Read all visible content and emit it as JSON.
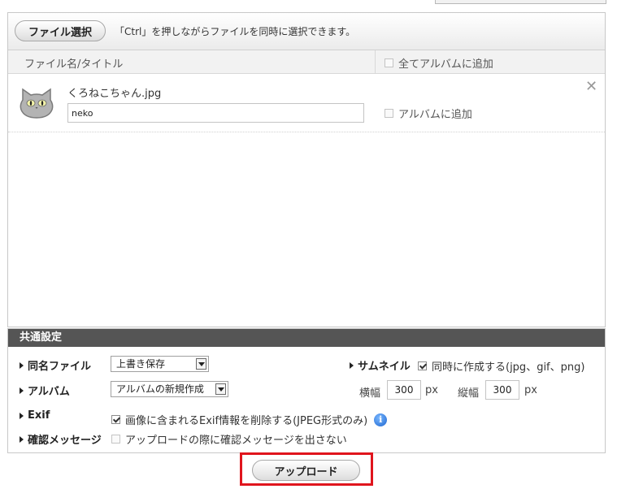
{
  "uploader": {
    "select_files_label": "ファイル選択",
    "hint": "「Ctrl」を押しながらファイルを同時に選択できます。",
    "column_title": "ファイル名/タイトル",
    "add_all_label": "全てアルバムに追加",
    "files": [
      {
        "filename": "くろねこちゃん.jpg",
        "title_value": "neko",
        "add_to_album_label": "アルバムに追加",
        "remove_symbol": "✕",
        "thumbnail_icon": "black-cat-icon"
      }
    ]
  },
  "settings": {
    "heading": "共通設定",
    "same_name": {
      "label": "同名ファイル",
      "selected": "上書き保存"
    },
    "album": {
      "label": "アルバム",
      "selected": "アルバムの新規作成"
    },
    "exif": {
      "label": "Exif",
      "checkbox_label": "画像に含まれるExif情報を削除する(JPEG形式のみ)",
      "checked": true,
      "info_symbol": "i"
    },
    "confirm": {
      "label": "確認メッセージ",
      "checkbox_label": "アップロードの際に確認メッセージを出さない",
      "checked": false
    },
    "thumbnail": {
      "label": "サムネイル",
      "checkbox_label": "同時に作成する(jpg、gif、png)",
      "checked": true,
      "width_label": "横幅",
      "width_value": "300",
      "height_label": "縦幅",
      "height_value": "300",
      "unit": "px"
    }
  },
  "upload_label": "アップロード",
  "colors": {
    "settings_header_bg": "#555555",
    "highlight_border": "#e0151d"
  }
}
